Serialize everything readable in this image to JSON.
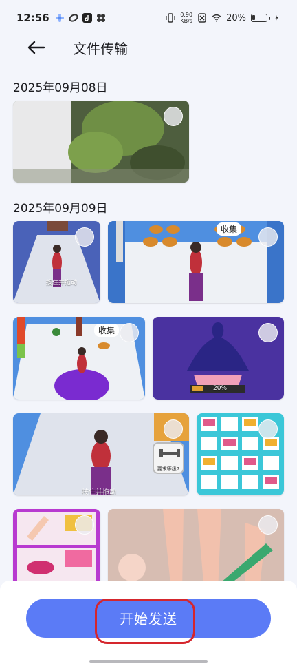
{
  "status_bar": {
    "time": "12:56",
    "net_speed_value": "0.90",
    "net_speed_unit": "KB/s",
    "battery": "20%"
  },
  "header": {
    "title": "文件传输"
  },
  "sections": [
    {
      "date": "2025年09月08日"
    },
    {
      "date": "2025年09月09日"
    }
  ],
  "thumb_labels": {
    "hold_drag_small": "按住并拖动",
    "collect": "收集",
    "collect2": "收集",
    "percent": "20%",
    "hold_drag": "按住并拖动",
    "required_level": "要求等级7"
  },
  "footer": {
    "send_label": "开始发送"
  },
  "colors": {
    "accent": "#5b7bf6",
    "annotation": "#d5262d"
  }
}
